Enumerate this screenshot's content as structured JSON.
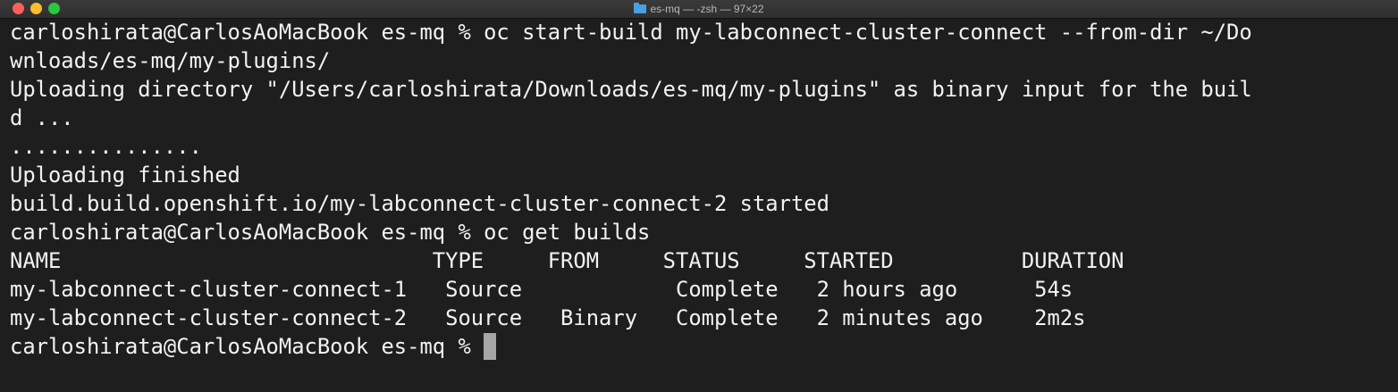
{
  "window": {
    "title": "es-mq — -zsh — 97×22"
  },
  "terminal": {
    "lines": [
      "carloshirata@CarlosAoMacBook es-mq % oc start-build my-labconnect-cluster-connect --from-dir ~/Do",
      "wnloads/es-mq/my-plugins/",
      "Uploading directory \"/Users/carloshirata/Downloads/es-mq/my-plugins\" as binary input for the buil",
      "d ...",
      "...............",
      "Uploading finished",
      "build.build.openshift.io/my-labconnect-cluster-connect-2 started",
      "carloshirata@CarlosAoMacBook es-mq % oc get builds",
      "NAME                             TYPE     FROM     STATUS     STARTED          DURATION",
      "my-labconnect-cluster-connect-1   Source            Complete   2 hours ago      54s",
      "my-labconnect-cluster-connect-2   Source   Binary   Complete   2 minutes ago    2m2s"
    ],
    "prompt": "carloshirata@CarlosAoMacBook es-mq % "
  },
  "colors": {
    "background": "#1e1e1e",
    "text": "#f2f2f2",
    "cursor": "#a6a6a6"
  }
}
